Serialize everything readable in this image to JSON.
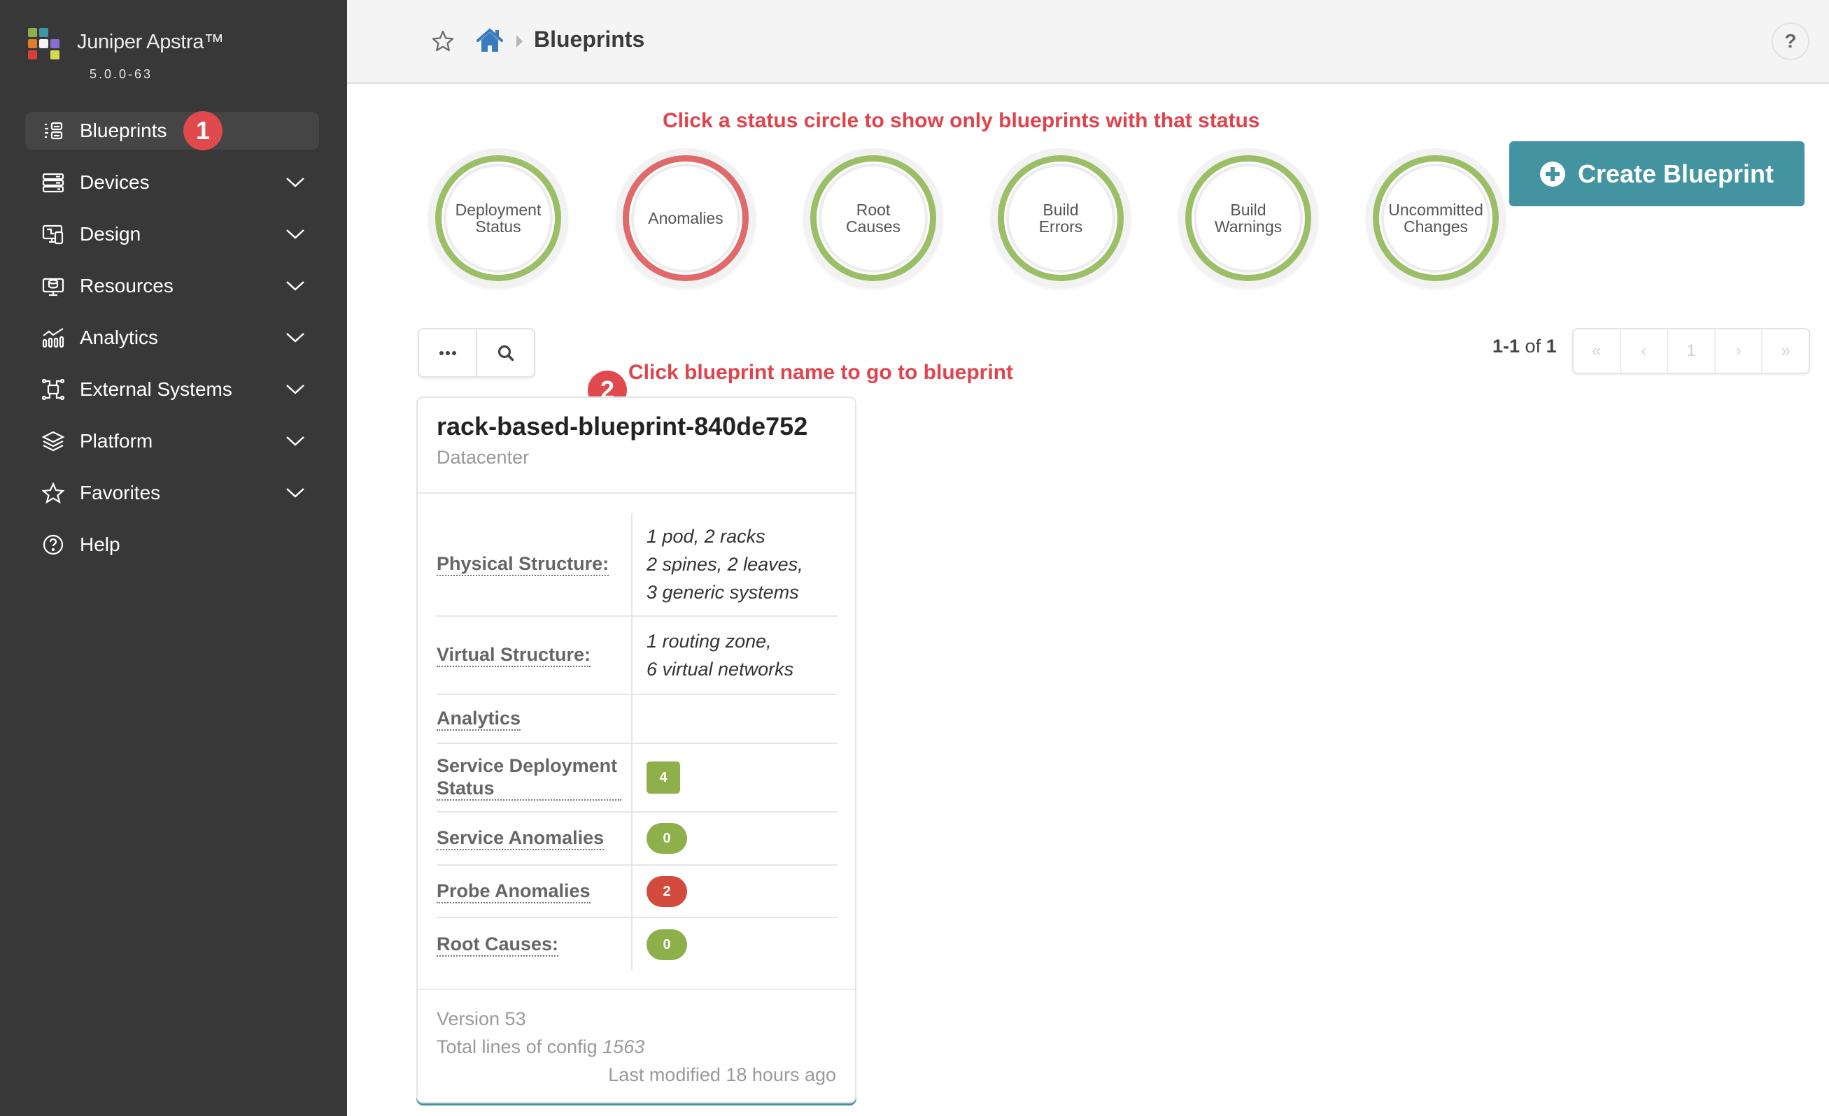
{
  "app": {
    "title": "Juniper Apstra™",
    "version": "5.0.0-63"
  },
  "sidebar": {
    "items": [
      {
        "label": "Blueprints",
        "icon": "blueprints-icon",
        "expandable": false,
        "active": true
      },
      {
        "label": "Devices",
        "icon": "devices-icon",
        "expandable": true
      },
      {
        "label": "Design",
        "icon": "design-icon",
        "expandable": true
      },
      {
        "label": "Resources",
        "icon": "resources-icon",
        "expandable": true
      },
      {
        "label": "Analytics",
        "icon": "analytics-icon",
        "expandable": true
      },
      {
        "label": "External Systems",
        "icon": "external-systems-icon",
        "expandable": true
      },
      {
        "label": "Platform",
        "icon": "platform-icon",
        "expandable": true
      },
      {
        "label": "Favorites",
        "icon": "star-icon",
        "expandable": true
      },
      {
        "label": "Help",
        "icon": "help-icon",
        "expandable": false
      }
    ]
  },
  "header": {
    "breadcrumb_current": "Blueprints",
    "help_label": "?"
  },
  "annotations": {
    "step1": "1",
    "step2": "2",
    "status_hint": "Click a status circle to show only blueprints with that status",
    "name_hint": "Click blueprint name to go to blueprint"
  },
  "status_circles": [
    {
      "line1": "Deployment",
      "line2": "Status",
      "status": "ok"
    },
    {
      "line1": "Anomalies",
      "line2": "",
      "status": "error"
    },
    {
      "line1": "Root",
      "line2": "Causes",
      "status": "ok"
    },
    {
      "line1": "Build",
      "line2": "Errors",
      "status": "ok"
    },
    {
      "line1": "Build",
      "line2": "Warnings",
      "status": "ok"
    },
    {
      "line1": "Uncommitted",
      "line2": "Changes",
      "status": "ok"
    }
  ],
  "create_button": {
    "label": "Create Blueprint"
  },
  "pagination": {
    "range": "1-1",
    "of_label": "of",
    "total": "1",
    "current_page": "1"
  },
  "blueprint": {
    "name": "rack-based-blueprint-840de752",
    "type": "Datacenter",
    "rows": [
      {
        "label": "Physical Structure:",
        "lines": [
          "1 pod, 2 racks",
          "2 spines, 2 leaves,",
          "3 generic systems"
        ]
      },
      {
        "label": "Virtual Structure:",
        "lines": [
          "1 routing zone,",
          "6 virtual networks"
        ]
      },
      {
        "label": "Analytics",
        "lines": []
      },
      {
        "label": "Service Deployment Status",
        "badge": "4",
        "badge_shape": "square",
        "badge_color": "#8db04b"
      },
      {
        "label": "Service Anomalies",
        "badge": "0",
        "badge_shape": "round",
        "badge_color": "#8db04b"
      },
      {
        "label": "Probe Anomalies",
        "badge": "2",
        "badge_shape": "round",
        "badge_color": "#d24b3d"
      },
      {
        "label": "Root Causes:",
        "badge": "0",
        "badge_shape": "round",
        "badge_color": "#8db04b"
      }
    ],
    "version_label": "Version 53",
    "config_label": "Total lines of config",
    "config_lines": "1563",
    "last_modified": "Last modified 18 hours ago"
  },
  "colors": {
    "ok": "#9bbf67",
    "error": "#e0696a",
    "accent": "#4393a1",
    "hint": "#e1434c",
    "sidebar": "#383838"
  }
}
